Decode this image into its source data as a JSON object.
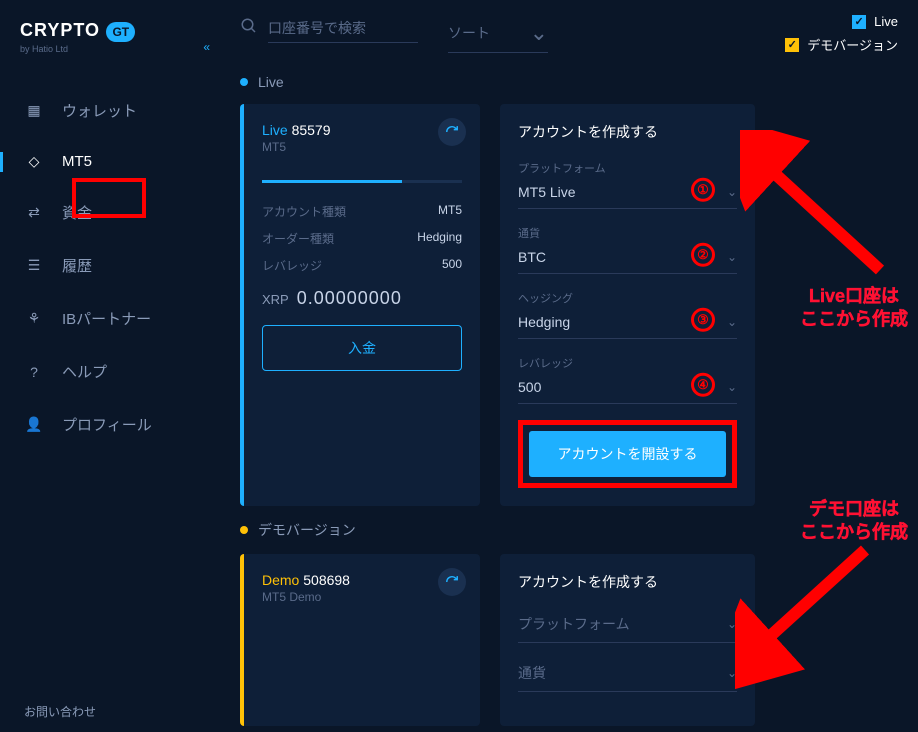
{
  "logo": {
    "brand": "CRYPTO",
    "badge": "GT",
    "sub": "by Hatio Ltd"
  },
  "nav": {
    "wallet": "ウォレット",
    "mt5": "MT5",
    "funds": "資金",
    "history": "履歴",
    "ib": "IBパートナー",
    "help": "ヘルプ",
    "profile": "プロフィール"
  },
  "footer": "お問い合わせ",
  "search": {
    "placeholder": "口座番号で検索"
  },
  "sort": {
    "label": "ソート"
  },
  "filters": {
    "live": "Live",
    "demo": "デモバージョン"
  },
  "sections": {
    "live": "Live",
    "demo": "デモバージョン"
  },
  "liveAccount": {
    "tag": "Live",
    "number": "85579",
    "platform": "MT5",
    "accountTypeLabel": "アカウント種類",
    "accountType": "MT5",
    "orderTypeLabel": "オーダー種類",
    "orderType": "Hedging",
    "leverageLabel": "レバレッジ",
    "leverage": "500",
    "currency": "XRP",
    "amount": "0.00000000",
    "deposit": "入金"
  },
  "liveForm": {
    "title": "アカウントを作成する",
    "platformLabel": "プラットフォーム",
    "platform": "MT5 Live",
    "currencyLabel": "通貨",
    "currency": "BTC",
    "hedgingLabel": "ヘッジング",
    "hedging": "Hedging",
    "leverageLabel": "レバレッジ",
    "leverage": "500",
    "submit": "アカウントを開設する"
  },
  "demoAccount": {
    "tag": "Demo",
    "number": "508698",
    "platform": "MT5 Demo"
  },
  "demoForm": {
    "title": "アカウントを作成する",
    "platformPh": "プラットフォーム",
    "currencyPh": "通貨"
  },
  "annotations": {
    "n1": "①",
    "n2": "②",
    "n3": "③",
    "n4": "④",
    "live_line1": "Live口座は",
    "live_line2": "ここから作成",
    "demo_line1": "デモ口座は",
    "demo_line2": "ここから作成"
  }
}
